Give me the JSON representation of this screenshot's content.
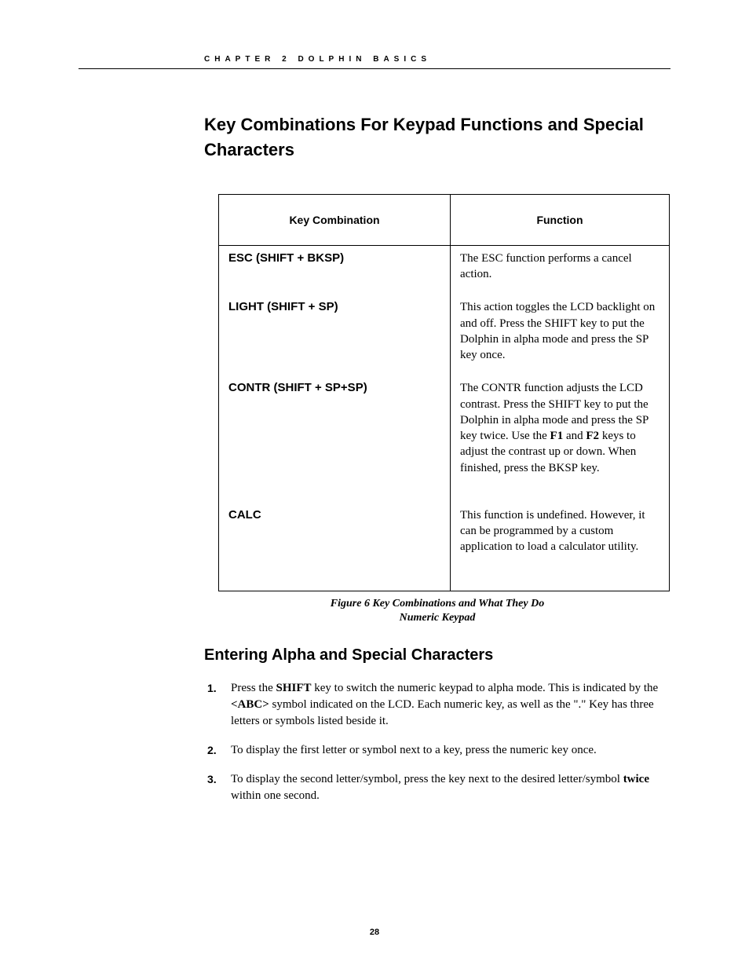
{
  "header": {
    "chapter_line": "CHAPTER 2 DOLPHIN BASICS"
  },
  "section_title": "Key Combinations For Keypad Functions and Special Characters",
  "table": {
    "headers": {
      "col1": "Key Combination",
      "col2": "Function"
    },
    "rows": [
      {
        "key": "ESC  (SHIFT + BKSP)",
        "func_pre": "The ESC function performs a cancel action."
      },
      {
        "key": "LIGHT (SHIFT + SP)",
        "func_pre": "This action toggles the LCD backlight on and off. Press the SHIFT key to put the Dolphin in alpha mode and press the SP key once."
      },
      {
        "key": "CONTR (SHIFT + SP+SP)",
        "func_pre": "The CONTR function adjusts the LCD contrast.  Press the SHIFT key to put the Dolphin in alpha mode and press the SP key twice.  Use the ",
        "bold1": "F1",
        "func_mid": " and ",
        "bold2": "F2",
        "func_post": " keys to adjust the contrast up or down. When finished, press the BKSP key."
      },
      {
        "key": "CALC",
        "func_pre": "This function is undefined.  However, it can be programmed by a custom application to load a calculator utility."
      }
    ]
  },
  "caption": "Figure 6  Key Combinations and What They Do",
  "subcaption": "Numeric Keypad",
  "subsection_title": "Entering Alpha and Special Characters",
  "steps": [
    {
      "pre": "Press the ",
      "b1": "SHIFT",
      "mid1": " key to switch the numeric keypad to alpha mode.  This is indicated by the ",
      "b2": "<ABC>",
      "mid2": " symbol indicated on the LCD.  Each numeric key, as well as the \".\" Key has three letters or symbols listed beside it."
    },
    {
      "pre": "To display the first letter or symbol next to a key, press the numeric key once."
    },
    {
      "pre": "To display the second letter/symbol, press the key next to the desired letter/symbol ",
      "b1": "twice",
      "mid1": " within one second."
    }
  ],
  "page_number": "28"
}
